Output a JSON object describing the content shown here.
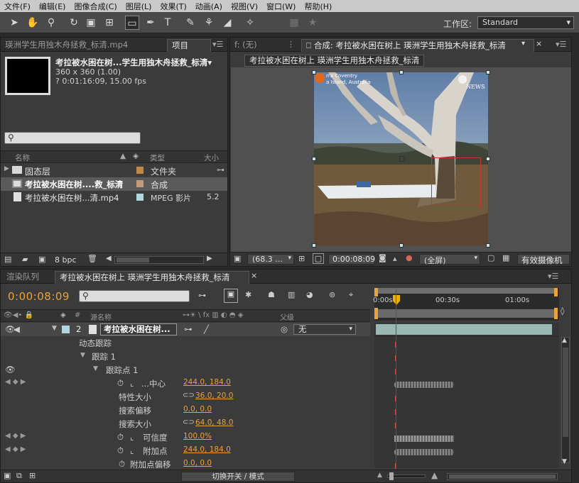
{
  "menu": [
    "文件(F)",
    "编辑(E)",
    "图像合成(C)",
    "图层(L)",
    "效果(T)",
    "动画(A)",
    "视图(V)",
    "窗口(W)",
    "帮助(H)"
  ],
  "toolbar": {
    "workspace_label": "工作区:",
    "workspace_value": "Standard"
  },
  "project_panel": {
    "left_tab": "瑛洲学生用独木舟拯救_标清.mp4",
    "tab": "项目",
    "menu_icon": "▾☰",
    "selected_name": "考拉被水困在树...学生用独木舟拯救_标清▾",
    "selected_dims": "360 x 360 (1.00)",
    "selected_duration": "? 0:01:16:09, 15.00 fps",
    "search_placeholder": "",
    "col_name": "名称",
    "col_type": "类型",
    "col_size": "大小",
    "items": [
      {
        "name": "固态层",
        "color": "#c0894a",
        "type": "文件夹",
        "size": ""
      },
      {
        "name": "考拉被水困在树....救_标清",
        "color": "#c59a7a",
        "type": "合成",
        "size": ""
      },
      {
        "name": "考拉被水困在树...清.mp4",
        "color": "#b0d6e0",
        "type": "MPEG 影片",
        "size": "5.2"
      }
    ],
    "footer_bpc": "8 bpc"
  },
  "viewer_panel": {
    "left_tab": "f: (无)",
    "tab": "合成: 考拉被水困在树上 瑛洲学生用独木舟拯救_标清",
    "breadcrumb": "考拉被水困在树上 瑛洲学生用独木舟拯救_标清",
    "overlay_left_1": "rra Coventry",
    "overlay_left_2": "a Island, Australia",
    "overlay_right": "NEWS",
    "zoom": "(68.3 ...",
    "timecode": "0:00:08:09",
    "resolution": "(全屏)",
    "camera": "有效摄像机"
  },
  "timeline_panel": {
    "tab_render": "渲染队列",
    "tab_comp": "考拉被水困在树上 瑛洲学生用独木舟拯救_标清",
    "timecode": "0:00:08:09",
    "ruler": [
      "0:00s",
      "00:30s",
      "01:00s"
    ],
    "col_source": "源名称",
    "col_parent": "父级",
    "col_hash": "#",
    "layer_index": "2",
    "layer_name": "考拉被水困在树...",
    "parent_value": "无",
    "rows": [
      {
        "label": "动态跟踪",
        "value": ""
      },
      {
        "label": "跟踪 1",
        "value": ""
      },
      {
        "label": "跟踪点 1",
        "value": ""
      },
      {
        "label": "...中心",
        "value": "244.0, 184.0"
      },
      {
        "label": "特性大小",
        "value": "36.0, 20.0"
      },
      {
        "label": "搜索偏移",
        "value": "0.0, 0.0"
      },
      {
        "label": "搜索大小",
        "value": "64.0, 48.0"
      },
      {
        "label": "可信度",
        "value": "100.0%"
      },
      {
        "label": "附加点",
        "value": "244.0, 184.0"
      },
      {
        "label": "附加点偏移",
        "value": "0.0, 0.0"
      }
    ],
    "footer_toggle": "切换开关 / 模式"
  },
  "colors": {
    "accent": "#e8a33c",
    "playhead": "#d42020",
    "track_bar": "#9ab8b2"
  }
}
